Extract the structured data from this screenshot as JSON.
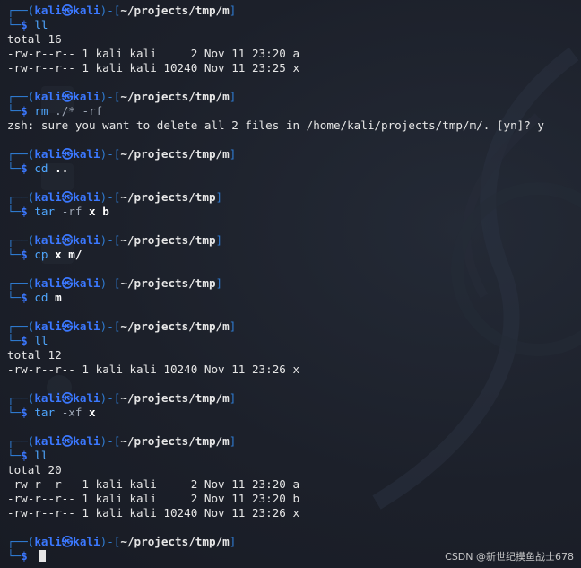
{
  "prompt": {
    "user": "kali",
    "host": "kali",
    "skull": "㉿"
  },
  "blocks": [
    {
      "path": "~/projects/tmp/m",
      "command": "ll",
      "args": [],
      "output": [
        "total 16",
        "-rw-r--r-- 1 kali kali     2 Nov 11 23:20 a",
        "-rw-r--r-- 1 kali kali 10240 Nov 11 23:25 x"
      ]
    },
    {
      "path": "~/projects/tmp/m",
      "command": "rm",
      "args": [
        {
          "text": "./*",
          "bold": false
        },
        {
          "text": "-rf",
          "bold": false
        }
      ],
      "output": [
        "zsh: sure you want to delete all 2 files in /home/kali/projects/tmp/m/. [yn]? y"
      ]
    },
    {
      "path": "~/projects/tmp/m",
      "command": "cd",
      "args": [
        {
          "text": "..",
          "bold": true
        }
      ],
      "output": []
    },
    {
      "path": "~/projects/tmp",
      "command": "tar",
      "args": [
        {
          "text": "-rf",
          "bold": false
        },
        {
          "text": "x",
          "bold": true
        },
        {
          "text": "b",
          "bold": true
        }
      ],
      "output": []
    },
    {
      "path": "~/projects/tmp",
      "command": "cp",
      "args": [
        {
          "text": "x",
          "bold": true
        },
        {
          "text": "m/",
          "bold": true
        }
      ],
      "output": []
    },
    {
      "path": "~/projects/tmp",
      "command": "cd",
      "args": [
        {
          "text": "m",
          "bold": true
        }
      ],
      "output": []
    },
    {
      "path": "~/projects/tmp/m",
      "command": "ll",
      "args": [],
      "output": [
        "total 12",
        "-rw-r--r-- 1 kali kali 10240 Nov 11 23:26 x"
      ]
    },
    {
      "path": "~/projects/tmp/m",
      "command": "tar",
      "args": [
        {
          "text": "-xf",
          "bold": false
        },
        {
          "text": "x",
          "bold": true
        }
      ],
      "output": []
    },
    {
      "path": "~/projects/tmp/m",
      "command": "ll",
      "args": [],
      "output": [
        "total 20",
        "-rw-r--r-- 1 kali kali     2 Nov 11 23:20 a",
        "-rw-r--r-- 1 kali kali     2 Nov 11 23:20 b",
        "-rw-r--r-- 1 kali kali 10240 Nov 11 23:26 x"
      ]
    },
    {
      "path": "~/projects/tmp/m",
      "command": "",
      "args": [],
      "output": [],
      "active": true
    }
  ],
  "watermark": "CSDN @新世纪摸鱼战士678",
  "colors": {
    "frame": "#2f7bd1",
    "userhost": "#3b78ff",
    "command": "#4fa7ff",
    "background": "#1c202a"
  }
}
